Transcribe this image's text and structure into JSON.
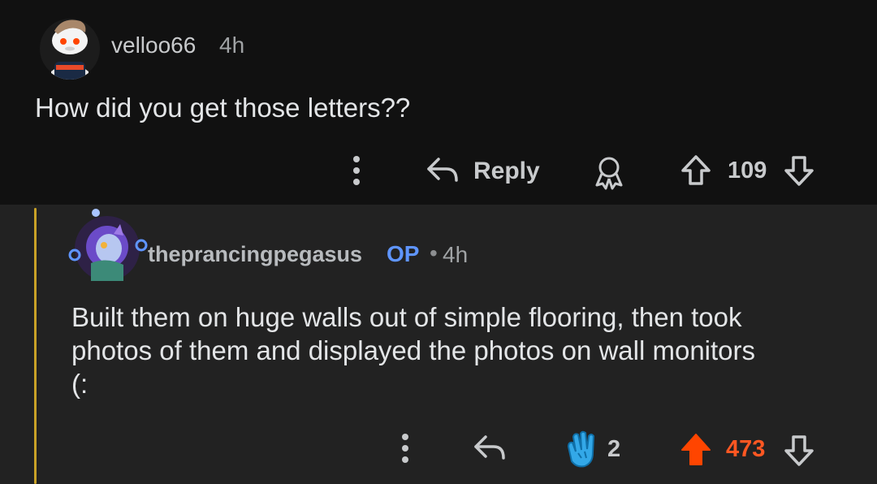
{
  "comments": [
    {
      "username": "velloo66",
      "time": "4h",
      "body": "How did you get those letters??",
      "actions": {
        "reply_label": "Reply",
        "score": "109",
        "vote_state": "none"
      }
    },
    {
      "username": "theprancingpegasus",
      "op_badge": "OP",
      "separator": "•",
      "time": "4h",
      "body_lines": [
        "Built them on huge walls out of simple flooring, then took",
        "photos of them and displayed the photos on wall monitors",
        "(:"
      ],
      "actions": {
        "award_count": "2",
        "score": "473",
        "vote_state": "upvoted"
      }
    }
  ],
  "colors": {
    "background_top": "#111111",
    "background_reply": "#222222",
    "thread_line": "#c9a227",
    "op_badge": "#5f95ff",
    "upvote_active": "#ff4500",
    "clap_award": "#33a8e8"
  },
  "icons": [
    "more-icon",
    "reply-arrow-icon",
    "award-icon",
    "upvote-icon",
    "downvote-icon",
    "clap-award-icon"
  ]
}
